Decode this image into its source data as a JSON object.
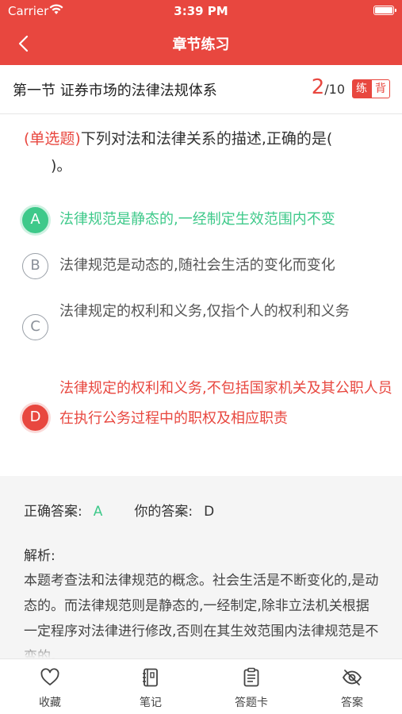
{
  "status_bar": {
    "carrier": "Carrier",
    "time": "3:39 PM"
  },
  "nav": {
    "title": "章节练习"
  },
  "section": {
    "title": "第一节 证券市场的法律法规体系",
    "current": "2",
    "total": "/10",
    "mode_practice": "练",
    "mode_recite": "背"
  },
  "question": {
    "type": "(单选题)",
    "text_line1": "下列对法和法律关系的描述,正确的是(",
    "text_line2": ")。"
  },
  "options": [
    {
      "letter": "A",
      "text": "法律规范是静态的,一经制定生效范围内不变",
      "state": "correct"
    },
    {
      "letter": "B",
      "text": "法律规范是动态的,随社会生活的变化而变化",
      "state": "normal"
    },
    {
      "letter": "C",
      "text": "法律规定的权利和义务,仅指个人的权利和义务",
      "state": "normal"
    },
    {
      "letter": "D",
      "text": "法律规定的权利和义务,不包括国家机关及其公职人员在执行公务过程中的职权及相应职责",
      "state": "wrong"
    }
  ],
  "answer": {
    "correct_label": "正确答案:",
    "correct_value": "A",
    "user_label": "你的答案:",
    "user_value": "D",
    "analysis_title": "解析:",
    "analysis_text": "本题考查法和法律规范的概念。社会生活是不断变化的,是动态的。而法律规范则是静态的,一经制定,除非立法机关根据一定程序对法律进行修改,否则在其生效范围内法律规范是不变的。"
  },
  "tabbar": [
    {
      "label": "收藏",
      "icon": "heart-icon"
    },
    {
      "label": "笔记",
      "icon": "notebook-icon"
    },
    {
      "label": "答题卡",
      "icon": "answer-card-icon"
    },
    {
      "label": "答案",
      "icon": "eye-off-icon"
    }
  ],
  "colors": {
    "brand": "#e8473f",
    "correct": "#3ec98a",
    "wrong": "#e8473f"
  }
}
